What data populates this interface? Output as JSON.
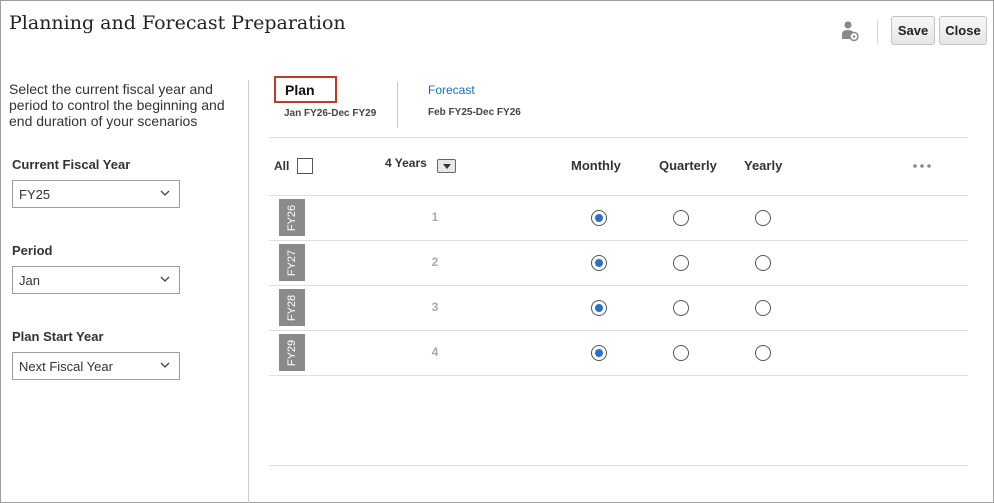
{
  "header": {
    "title": "Planning and Forecast Preparation",
    "user_icon": "user-settings-icon",
    "save_label": "Save",
    "close_label": "Close"
  },
  "left_panel": {
    "description": "Select the current fiscal year and period to control the beginning and end duration of your scenarios",
    "fields": [
      {
        "label": "Current Fiscal Year",
        "value": "FY25"
      },
      {
        "label": "Period",
        "value": "Jan"
      },
      {
        "label": "Plan Start Year",
        "value": "Next Fiscal Year"
      }
    ]
  },
  "tabs": {
    "plan": {
      "label": "Plan",
      "range": "Jan FY26-Dec FY29"
    },
    "forecast": {
      "label": "Forecast",
      "range": "Feb FY25-Dec FY26"
    }
  },
  "grid": {
    "all_label": "All",
    "years_label": "4 Years",
    "columns": [
      "Monthly",
      "Quarterly",
      "Yearly"
    ],
    "more_icon": "more-horizontal-icon",
    "rows": [
      {
        "fy": "FY26",
        "num": "1",
        "selected": "Monthly"
      },
      {
        "fy": "FY27",
        "num": "2",
        "selected": "Monthly"
      },
      {
        "fy": "FY28",
        "num": "3",
        "selected": "Monthly"
      },
      {
        "fy": "FY29",
        "num": "4",
        "selected": "Monthly"
      }
    ]
  },
  "colors": {
    "accent": "#2a6fc9",
    "highlight_border": "#c0392b",
    "link": "#1f6fb2",
    "fy_tag": "#8a8a8a"
  }
}
